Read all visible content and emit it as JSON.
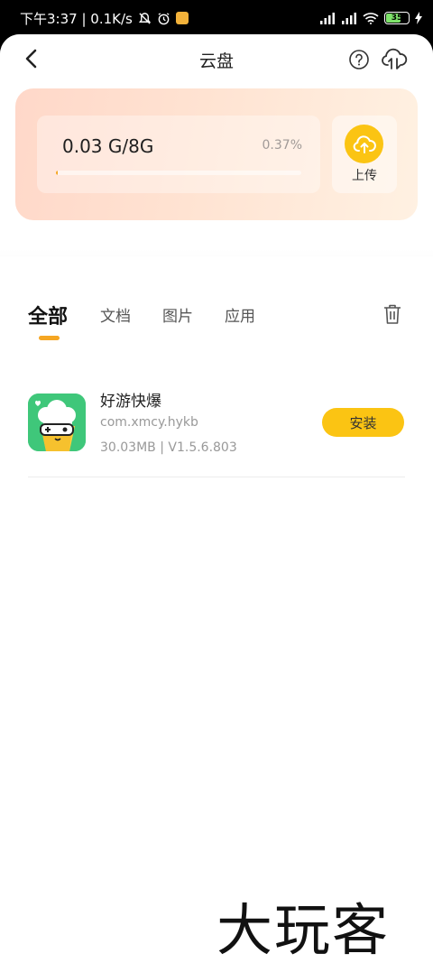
{
  "status_bar": {
    "time_and_speed": "下午3:37 | 0.1K/s",
    "battery_level": "35"
  },
  "nav": {
    "title": "云盘"
  },
  "storage": {
    "usage": "0.03 G/8G",
    "percent": "0.37%",
    "progress_fraction": 0.0037,
    "upload_label": "上传"
  },
  "tabs": [
    {
      "label": "全部",
      "active": true
    },
    {
      "label": "文档",
      "active": false
    },
    {
      "label": "图片",
      "active": false
    },
    {
      "label": "应用",
      "active": false
    }
  ],
  "files": [
    {
      "name": "好游快爆",
      "package": "com.xmcy.hykb",
      "meta": "30.03MB | V1.5.6.803",
      "action_label": "安装",
      "icon": "popcorn-character-icon"
    }
  ],
  "watermark": "大玩客",
  "colors": {
    "accent_yellow": "#fbc413",
    "accent_orange": "#f5a623",
    "card_peach": "#ffd8c9",
    "app_icon_green": "#3fc77a"
  }
}
